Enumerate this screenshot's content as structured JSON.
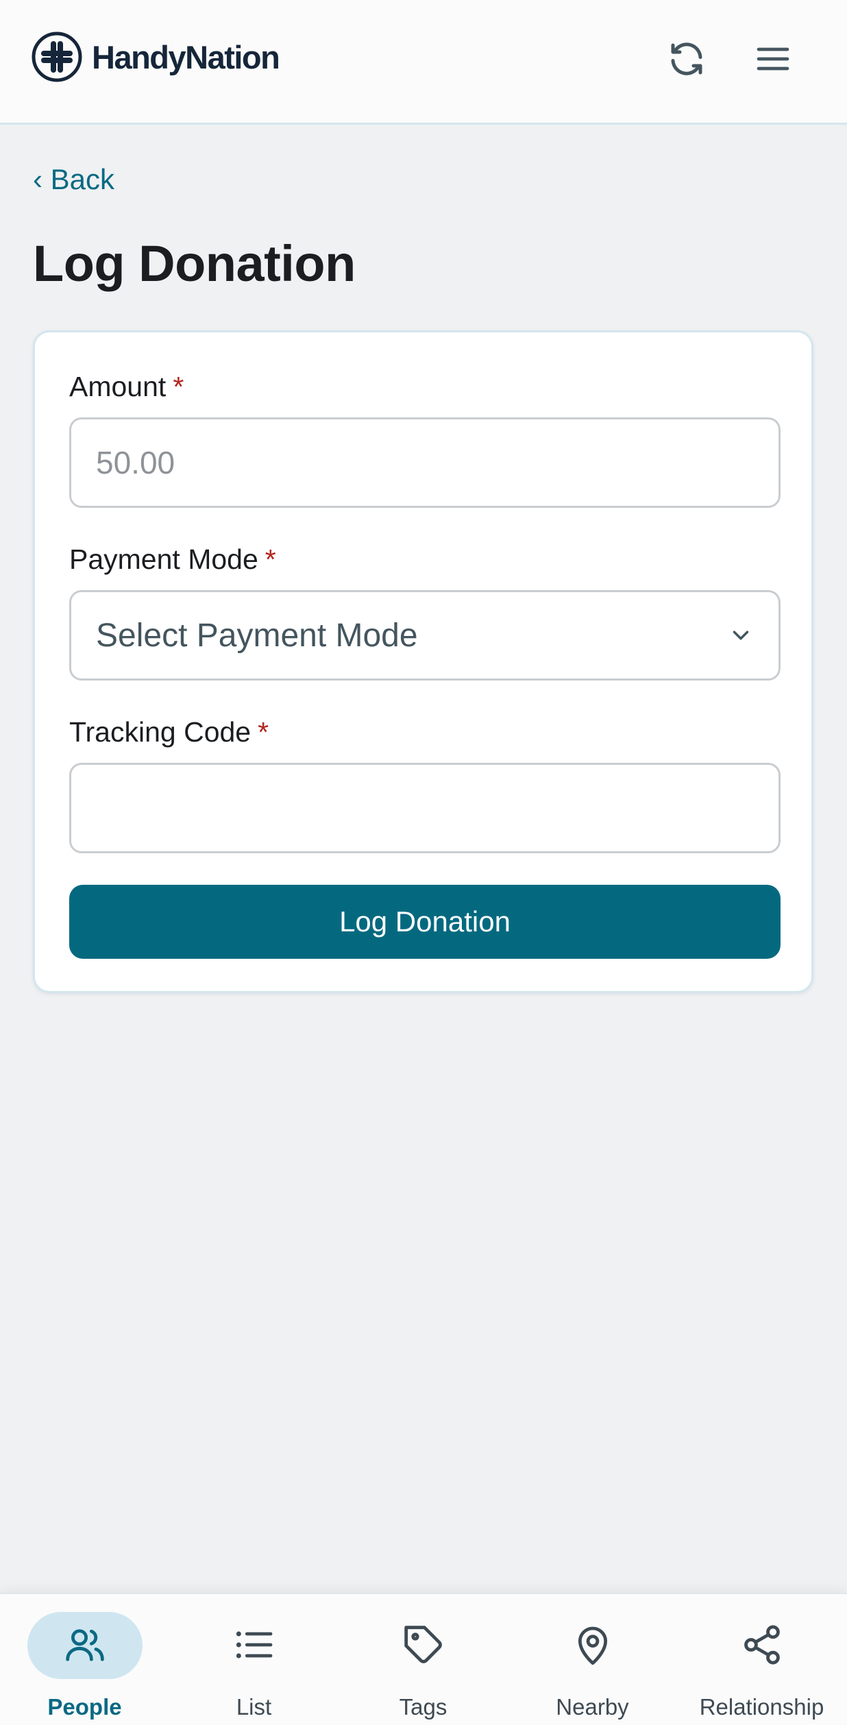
{
  "header": {
    "brand": "HandyNation",
    "refresh_icon": "refresh-icon",
    "menu_icon": "hamburger-menu-icon"
  },
  "back_label": "‹ Back",
  "page_title": "Log Donation",
  "form": {
    "amount": {
      "label": "Amount",
      "required_mark": "*",
      "placeholder": "50.00",
      "value": ""
    },
    "payment_mode": {
      "label": "Payment Mode",
      "required_mark": "*",
      "selected": "Select Payment Mode"
    },
    "tracking_code": {
      "label": "Tracking Code",
      "required_mark": "*",
      "value": ""
    },
    "submit_label": "Log Donation"
  },
  "bottom_nav": {
    "items": [
      {
        "label": "People",
        "icon": "people-icon",
        "active": true
      },
      {
        "label": "List",
        "icon": "list-icon",
        "active": false
      },
      {
        "label": "Tags",
        "icon": "tag-icon",
        "active": false
      },
      {
        "label": "Nearby",
        "icon": "location-pin-icon",
        "active": false
      },
      {
        "label": "Relationship",
        "icon": "share-network-icon",
        "active": false
      }
    ]
  },
  "colors": {
    "accent": "#04697f",
    "link": "#0b6983",
    "required": "#b3261e",
    "background": "#eff1f3",
    "active_pill": "#cfe6f1"
  }
}
